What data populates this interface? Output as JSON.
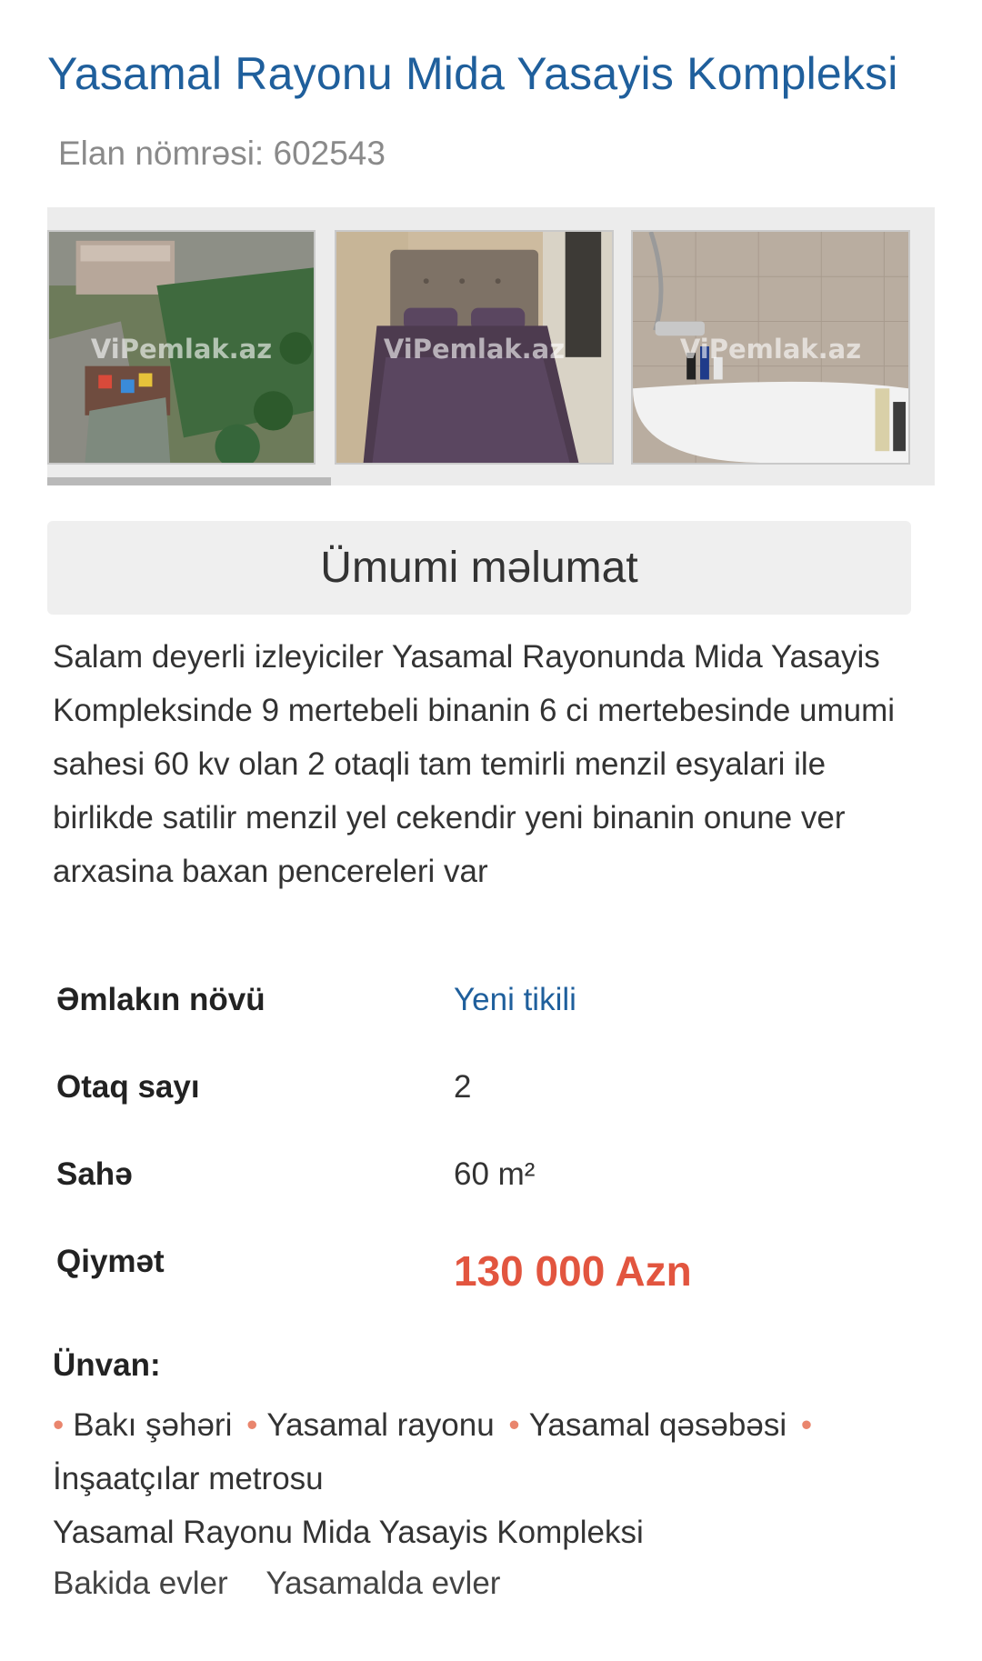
{
  "listing": {
    "title": "Yasamal Rayonu Mida Yasayis Kompleksi",
    "listing_number": "Elan nömrəsi: 602543"
  },
  "gallery": {
    "watermark": "ViPemlak.az",
    "images": [
      {
        "name": "aerial-playground-photo"
      },
      {
        "name": "bedroom-photo"
      },
      {
        "name": "bathroom-photo"
      }
    ],
    "scroll_fraction": 0.32
  },
  "section": {
    "title": "Ümumi məlumat"
  },
  "description": "Salam deyerli izleyiciler Yasamal Rayonunda Mida Yasayis Kompleksinde 9 mertebeli binanin 6 ci mertebesinde umumi sahesi 60 kv olan 2 otaqli tam temirli menzil esyalari ile birlikde satilir menzil yel cekendir yeni binanin onune ver arxasina baxan pencereleri var",
  "properties": [
    {
      "label": "Əmlakın növü",
      "value": "Yeni tikili"
    },
    {
      "label": "Otaq sayı",
      "value": "2"
    },
    {
      "label": "Sahə",
      "value": "60 m²"
    },
    {
      "label": "Qiymət",
      "value": "130 000 Azn"
    }
  ],
  "address": {
    "label": "Ünvan:",
    "parts": [
      "Bakı şəhəri",
      "Yasamal rayonu",
      "Yasamal qəsəbəsi",
      "İnşaatçılar metrosu"
    ],
    "complex": "Yasamal Rayonu Mida Yasayis Kompleksi"
  },
  "tags": [
    "Bakida evler",
    "Yasamalda evler"
  ],
  "colors": {
    "title": "#1f5f9c",
    "price": "#e2553f",
    "bullet": "#e9856d",
    "section_bg": "#efefef"
  }
}
